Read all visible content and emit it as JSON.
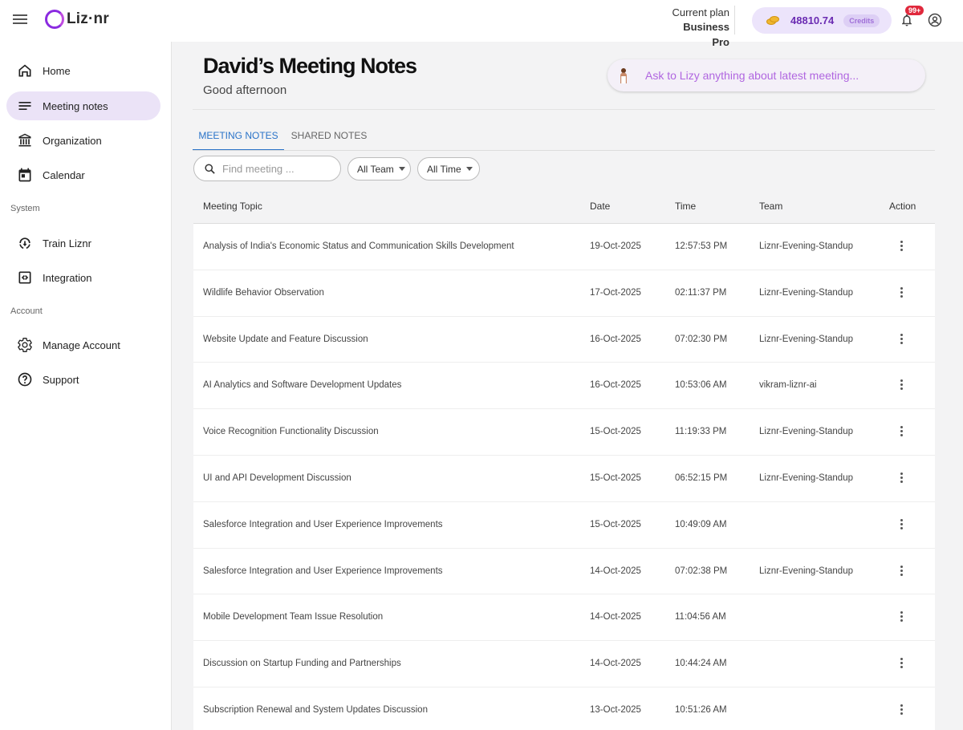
{
  "header": {
    "logo_text": "Liz·nr",
    "plan_label": "Current plan",
    "plan_value": "Business Pro",
    "credits_amount": "48810.74",
    "credits_label": "Credits",
    "notification_badge": "99+"
  },
  "sidebar": {
    "items": [
      {
        "label": "Home",
        "icon": "home-icon"
      },
      {
        "label": "Meeting notes",
        "icon": "notes-icon"
      },
      {
        "label": "Organization",
        "icon": "organization-icon"
      },
      {
        "label": "Calendar",
        "icon": "calendar-icon"
      }
    ],
    "system_label": "System",
    "system_items": [
      {
        "label": "Train Liznr",
        "icon": "train-icon"
      },
      {
        "label": "Integration",
        "icon": "integration-icon"
      }
    ],
    "account_label": "Account",
    "account_items": [
      {
        "label": "Manage Account",
        "icon": "gear-icon"
      },
      {
        "label": "Support",
        "icon": "help-icon"
      }
    ],
    "active_item": "Meeting notes"
  },
  "main": {
    "title": "David’s Meeting Notes",
    "greeting": "Good afternoon",
    "ask_placeholder": "Ask to Lizy anything about latest meeting...",
    "tabs": [
      {
        "label": "MEETING NOTES",
        "active": true
      },
      {
        "label": "SHARED NOTES",
        "active": false
      }
    ],
    "search_placeholder": "Find meeting ...",
    "filters": [
      {
        "label": "All Team"
      },
      {
        "label": "All Time"
      }
    ]
  },
  "table": {
    "columns": [
      "Meeting Topic",
      "Date",
      "Time",
      "Team",
      "Action"
    ],
    "rows": [
      {
        "topic": "Analysis of India's Economic Status and Communication Skills Development",
        "date": "19-Oct-2025",
        "time": "12:57:53 PM",
        "team": "Liznr-Evening-Standup"
      },
      {
        "topic": "Wildlife Behavior Observation",
        "date": "17-Oct-2025",
        "time": "02:11:37 PM",
        "team": "Liznr-Evening-Standup"
      },
      {
        "topic": "Website Update and Feature Discussion",
        "date": "16-Oct-2025",
        "time": "07:02:30 PM",
        "team": "Liznr-Evening-Standup"
      },
      {
        "topic": "AI Analytics and Software Development Updates",
        "date": "16-Oct-2025",
        "time": "10:53:06 AM",
        "team": "vikram-liznr-ai"
      },
      {
        "topic": "Voice Recognition Functionality Discussion",
        "date": "15-Oct-2025",
        "time": "11:19:33 PM",
        "team": "Liznr-Evening-Standup"
      },
      {
        "topic": "UI and API Development Discussion",
        "date": "15-Oct-2025",
        "time": "06:52:15 PM",
        "team": "Liznr-Evening-Standup"
      },
      {
        "topic": "Salesforce Integration and User Experience Improvements",
        "date": "15-Oct-2025",
        "time": "10:49:09 AM",
        "team": ""
      },
      {
        "topic": "Salesforce Integration and User Experience Improvements",
        "date": "14-Oct-2025",
        "time": "07:02:38 PM",
        "team": "Liznr-Evening-Standup"
      },
      {
        "topic": "Mobile Development Team Issue Resolution",
        "date": "14-Oct-2025",
        "time": "11:04:56 AM",
        "team": ""
      },
      {
        "topic": "Discussion on Startup Funding and Partnerships",
        "date": "14-Oct-2025",
        "time": "10:44:24 AM",
        "team": ""
      },
      {
        "topic": "Subscription Renewal and System Updates Discussion",
        "date": "13-Oct-2025",
        "time": "10:51:26 AM",
        "team": ""
      }
    ]
  },
  "colors": {
    "accent": "#2a73c8",
    "brand_purple": "#8b2be0",
    "active_nav_bg": "#ebe3f7",
    "credits_bg": "#ece4fb",
    "badge_red": "#e0283c"
  }
}
